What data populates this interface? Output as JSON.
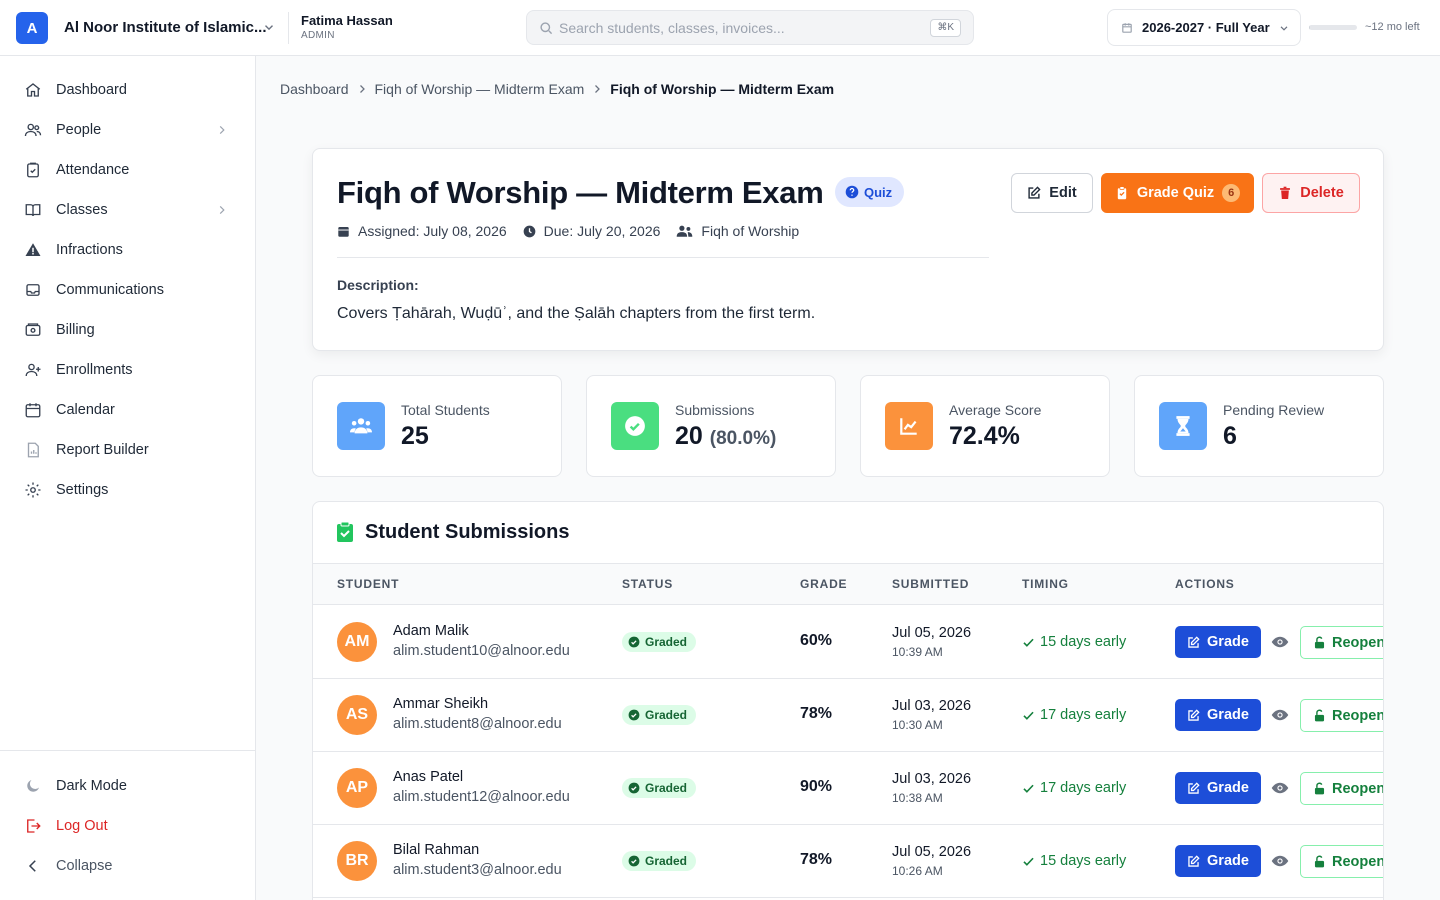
{
  "org": {
    "logo_letter": "A",
    "name": "Al Noor Institute of Islamic..."
  },
  "user": {
    "name": "Fatima Hassan",
    "role": "ADMIN"
  },
  "search": {
    "placeholder": "Search students, classes, invoices...",
    "shortcut": "⌘K"
  },
  "academic_year": {
    "label": "2026-2027 · Full Year",
    "remaining": "~12 mo left",
    "elapsed_fraction": 0.02
  },
  "sidebar": {
    "items": [
      {
        "label": "Dashboard",
        "icon": "home-icon"
      },
      {
        "label": "People",
        "icon": "users-icon",
        "has_children": true
      },
      {
        "label": "Attendance",
        "icon": "clipboard-check-icon"
      },
      {
        "label": "Classes",
        "icon": "book-open-icon",
        "has_children": true
      },
      {
        "label": "Infractions",
        "icon": "warning-icon"
      },
      {
        "label": "Communications",
        "icon": "inbox-icon"
      },
      {
        "label": "Billing",
        "icon": "cash-icon"
      },
      {
        "label": "Enrollments",
        "icon": "user-plus-icon"
      },
      {
        "label": "Calendar",
        "icon": "calendar-icon"
      },
      {
        "label": "Report Builder",
        "icon": "document-chart-icon"
      },
      {
        "label": "Settings",
        "icon": "gear-icon"
      }
    ],
    "bottom": {
      "dark_mode": "Dark Mode",
      "logout": "Log Out",
      "collapse": "Collapse"
    }
  },
  "breadcrumb": [
    "Dashboard",
    "Fiqh of Worship — Midterm Exam",
    "Fiqh of Worship — Midterm Exam"
  ],
  "assignment": {
    "title": "Fiqh of Worship — Midterm Exam",
    "type": "Quiz",
    "assigned": "Assigned: July 08, 2026",
    "due": "Due: July 20, 2026",
    "class": "Fiqh of Worship",
    "description_label": "Description:",
    "description": "Covers Ṭahārah, Wuḍūʾ, and the Ṣalāh chapters from the first term.",
    "actions": {
      "edit": "Edit",
      "grade": "Grade Quiz",
      "grade_count": "6",
      "delete": "Delete"
    }
  },
  "stats": [
    {
      "label": "Total Students",
      "value": "25",
      "sub": "",
      "color": "#60a5fa",
      "icon": "users-icon"
    },
    {
      "label": "Submissions",
      "value": "20",
      "sub": "(80.0%)",
      "color": "#4ade80",
      "icon": "check-circle-icon"
    },
    {
      "label": "Average Score",
      "value": "72.4%",
      "sub": "",
      "color": "#fb923c",
      "icon": "chart-line-icon"
    },
    {
      "label": "Pending Review",
      "value": "6",
      "sub": "",
      "color": "#60a5fa",
      "icon": "hourglass-icon"
    }
  ],
  "submissions": {
    "title": "Student Submissions",
    "columns": [
      "STUDENT",
      "STATUS",
      "GRADE",
      "SUBMITTED",
      "TIMING",
      "ACTIONS"
    ],
    "grade_btn": "Grade",
    "reopen_btn": "Reopen",
    "rows": [
      {
        "initials": "AM",
        "name": "Adam Malik",
        "email": "alim.student10@alnoor.edu",
        "status": "Graded",
        "grade": "60%",
        "date": "Jul 05, 2026",
        "time": "10:39 AM",
        "timing": "15 days early"
      },
      {
        "initials": "AS",
        "name": "Ammar Sheikh",
        "email": "alim.student8@alnoor.edu",
        "status": "Graded",
        "grade": "78%",
        "date": "Jul 03, 2026",
        "time": "10:30 AM",
        "timing": "17 days early"
      },
      {
        "initials": "AP",
        "name": "Anas Patel",
        "email": "alim.student12@alnoor.edu",
        "status": "Graded",
        "grade": "90%",
        "date": "Jul 03, 2026",
        "time": "10:38 AM",
        "timing": "17 days early"
      },
      {
        "initials": "BR",
        "name": "Bilal Rahman",
        "email": "alim.student3@alnoor.edu",
        "status": "Graded",
        "grade": "78%",
        "date": "Jul 05, 2026",
        "time": "10:26 AM",
        "timing": "15 days early"
      }
    ]
  },
  "colors": {
    "primary": "#2563eb",
    "orange": "#f97316",
    "danger": "#dc2626",
    "success": "#15803d"
  }
}
